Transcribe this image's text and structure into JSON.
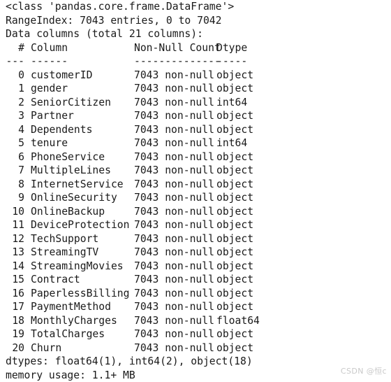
{
  "output": {
    "class_line": "<class 'pandas.core.frame.DataFrame'>",
    "range_index_line": "RangeIndex: 7043 entries, 0 to 7042",
    "data_columns_line": "Data columns (total 21 columns):",
    "header": {
      "idx": "#",
      "name": "Column",
      "count": "Non-Null Count",
      "dtype": "Dtype"
    },
    "rule": {
      "idx": "---",
      "name": "------",
      "count": "--------------",
      "dtype": "-----"
    },
    "rows": [
      {
        "idx": "0",
        "name": "customerID",
        "count": "7043 non-null",
        "dtype": "object"
      },
      {
        "idx": "1",
        "name": "gender",
        "count": "7043 non-null",
        "dtype": "object"
      },
      {
        "idx": "2",
        "name": "SeniorCitizen",
        "count": "7043 non-null",
        "dtype": "int64"
      },
      {
        "idx": "3",
        "name": "Partner",
        "count": "7043 non-null",
        "dtype": "object"
      },
      {
        "idx": "4",
        "name": "Dependents",
        "count": "7043 non-null",
        "dtype": "object"
      },
      {
        "idx": "5",
        "name": "tenure",
        "count": "7043 non-null",
        "dtype": "int64"
      },
      {
        "idx": "6",
        "name": "PhoneService",
        "count": "7043 non-null",
        "dtype": "object"
      },
      {
        "idx": "7",
        "name": "MultipleLines",
        "count": "7043 non-null",
        "dtype": "object"
      },
      {
        "idx": "8",
        "name": "InternetService",
        "count": "7043 non-null",
        "dtype": "object"
      },
      {
        "idx": "9",
        "name": "OnlineSecurity",
        "count": "7043 non-null",
        "dtype": "object"
      },
      {
        "idx": "10",
        "name": "OnlineBackup",
        "count": "7043 non-null",
        "dtype": "object"
      },
      {
        "idx": "11",
        "name": "DeviceProtection",
        "count": "7043 non-null",
        "dtype": "object"
      },
      {
        "idx": "12",
        "name": "TechSupport",
        "count": "7043 non-null",
        "dtype": "object"
      },
      {
        "idx": "13",
        "name": "StreamingTV",
        "count": "7043 non-null",
        "dtype": "object"
      },
      {
        "idx": "14",
        "name": "StreamingMovies",
        "count": "7043 non-null",
        "dtype": "object"
      },
      {
        "idx": "15",
        "name": "Contract",
        "count": "7043 non-null",
        "dtype": "object"
      },
      {
        "idx": "16",
        "name": "PaperlessBilling",
        "count": "7043 non-null",
        "dtype": "object"
      },
      {
        "idx": "17",
        "name": "PaymentMethod",
        "count": "7043 non-null",
        "dtype": "object"
      },
      {
        "idx": "18",
        "name": "MonthlyCharges",
        "count": "7043 non-null",
        "dtype": "float64"
      },
      {
        "idx": "19",
        "name": "TotalCharges",
        "count": "7043 non-null",
        "dtype": "object"
      },
      {
        "idx": "20",
        "name": "Churn",
        "count": "7043 non-null",
        "dtype": "object"
      }
    ],
    "dtypes_line": "dtypes: float64(1), int64(2), object(18)",
    "memory_usage_line": "memory usage: 1.1+ MB"
  },
  "watermark": {
    "text": "CSDN @恒c"
  }
}
